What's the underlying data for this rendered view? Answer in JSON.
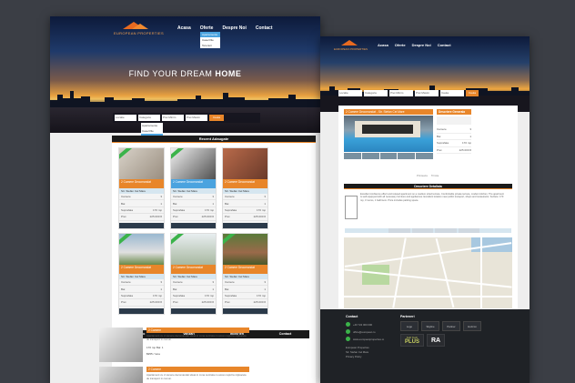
{
  "left_page": {
    "logo_text": "EUROPEAN PROPERTIES",
    "nav": [
      "Acasa",
      "Oferte",
      "Despre Noi",
      "Contact"
    ],
    "nav_dropdown": [
      "Apartamente",
      "Case/Vile",
      "Terenuri"
    ],
    "hero_title_prefix": "FIND YOUR DREAM",
    "hero_title_bold": "HOME",
    "search": {
      "fields": [
        "Locatie",
        "Categorie",
        "Pret Minim",
        "Pret Maxim"
      ],
      "button": "Cauta"
    },
    "category_options": [
      "Apartamente",
      "Case/Vile",
      "Terenuri"
    ],
    "section_header": "Recent Adaugate",
    "cards": [
      {
        "title": "2 Camere Decomandat",
        "addr": "Str. Stefan Cel Mare",
        "rows": [
          [
            "Camere",
            "3"
          ],
          [
            "Bai",
            "1"
          ],
          [
            "Suprafata",
            "170 mp"
          ],
          [
            "Pret",
            "225.000 €"
          ]
        ],
        "blue": false
      },
      {
        "title": "2 Camere Decomandat",
        "addr": "Str. Stefan Cel Mare",
        "rows": [
          [
            "Camere",
            "3"
          ],
          [
            "Bai",
            "1"
          ],
          [
            "Suprafata",
            "170 mp"
          ],
          [
            "Pret",
            "225.000 €"
          ]
        ],
        "blue": true
      },
      {
        "title": "2 Camere Decomandat",
        "addr": "Str. Stefan Cel Mare",
        "rows": [
          [
            "Camere",
            "3"
          ],
          [
            "Bai",
            "1"
          ],
          [
            "Suprafata",
            "170 mp"
          ],
          [
            "Pret",
            "225.000 €"
          ]
        ],
        "blue": false
      },
      {
        "title": "2 Camere Decomandat",
        "addr": "Str. Stefan Cel Mare",
        "rows": [
          [
            "Camere",
            "3"
          ],
          [
            "Bai",
            "1"
          ],
          [
            "Suprafata",
            "170 mp"
          ],
          [
            "Pret",
            "225.000 €"
          ]
        ],
        "blue": false
      },
      {
        "title": "2 Camere Decomandat",
        "addr": "Str. Stefan Cel Mare",
        "rows": [
          [
            "Camere",
            "3"
          ],
          [
            "Bai",
            "1"
          ],
          [
            "Suprafata",
            "170 mp"
          ],
          [
            "Pret",
            "225.000 €"
          ]
        ],
        "blue": false
      },
      {
        "title": "2 Camere Decomandat",
        "addr": "Str. Stefan Cel Mare",
        "rows": [
          [
            "Camere",
            "3"
          ],
          [
            "Bai",
            "1"
          ],
          [
            "Suprafata",
            "170 mp"
          ],
          [
            "Pret",
            "225.000 €"
          ]
        ],
        "blue": false
      }
    ],
    "tabs": [
      "Video",
      "Vanzari",
      "Inchirieri",
      "Contact"
    ],
    "list_items": [
      {
        "title": "2 Camere",
        "text": "Apartament cu 2 camere decomandat situat in zona centrala cu acces rapid la mijloacele de transport in comun.",
        "meta": "170 mp  Bai: 1",
        "price": "$955 / luna"
      },
      {
        "title": "2 Camere",
        "text": "Apartament cu 2 camere decomandat situat in zona centrala cu acces rapid la mijloacele de transport in comun.",
        "meta": "170 mp  Bai: 1",
        "price": "$955 / luna"
      }
    ]
  },
  "right_page": {
    "logo_text": "EUROPEAN PROPERTIES",
    "nav": [
      "Acasa",
      "Oferte",
      "Despre Noi",
      "Contact"
    ],
    "search": {
      "fields": [
        "Locatie",
        "Categorie",
        "Pret Minim",
        "Pret Maxim",
        "Cauta"
      ],
      "button": "Cauta"
    },
    "listing_title": "2 Camere Decomandat - Str. Stefan Cel Mare",
    "side_header": "Descriere Generala",
    "side_rows": [
      [
        "Camere",
        "3"
      ],
      [
        "Bai",
        "1"
      ],
      [
        "Suprafata",
        "170 mp"
      ],
      [
        "Pret",
        "225.000 €"
      ]
    ],
    "actions": [
      "Printeaza",
      "Trimite"
    ],
    "details_header": "Descriere Detaliata",
    "description": "Excellent Ambience effect and relaxed apartment on a medium sized terrace. Comfortable private terrace, modern kitchen. The apartment is well equipped with all necessary furniture and appliances. Excellent location near public transport, shops and restaurants. Surface: 170 mp, 3 rooms, 1 bathroom. Price includes parking space.",
    "footer": {
      "contact_header": "Contact",
      "contact_lines": [
        "+40 722 000 000",
        "office@european.ro",
        "www.europeanproperties.ro"
      ],
      "address_lines": [
        "European Properties",
        "Str. Stefan Cel Mare",
        "Privacy Policy"
      ],
      "partners_header": "Parteneri",
      "partners": [
        "Logo",
        "Skyline",
        "Partner",
        "Horizon"
      ],
      "plus_logo_top": "Soft Tech",
      "plus_logo_bottom": "PLUS",
      "ra_logo": "RA"
    }
  },
  "colors": {
    "accent": "#e8862a",
    "blue": "#4aa3df",
    "green": "#3bb34a",
    "dark": "#1a1a1a",
    "background": "#3b3e45"
  }
}
